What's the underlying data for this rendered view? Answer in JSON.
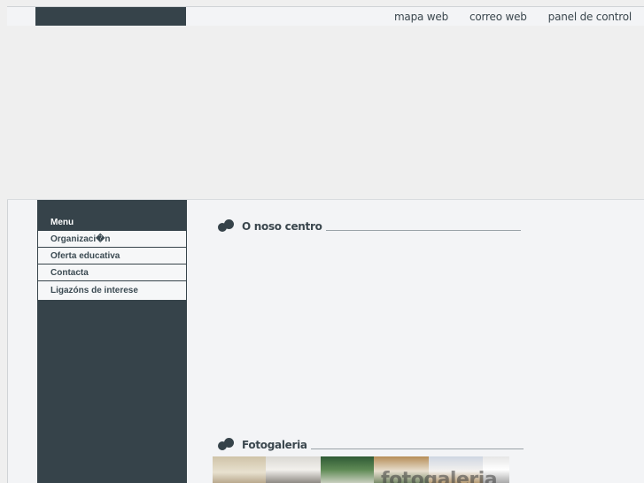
{
  "header": {
    "nav": [
      {
        "label": "mapa web"
      },
      {
        "label": "correo web"
      },
      {
        "label": "panel de control"
      }
    ]
  },
  "sidebar": {
    "title": "Menu",
    "items": [
      {
        "label": "Organizaci�n"
      },
      {
        "label": "Oferta educativa"
      },
      {
        "label": "Contacta"
      },
      {
        "label": ""
      },
      {
        "label": "Ligazóns de interese"
      }
    ]
  },
  "content": {
    "about_title": "O noso centro",
    "gallery_title": "Fotogaleria",
    "gallery_overlay": "fotogaleria"
  },
  "colors": {
    "dark": "#36434a",
    "panel": "#f3f4f6",
    "background": "#efefef"
  }
}
